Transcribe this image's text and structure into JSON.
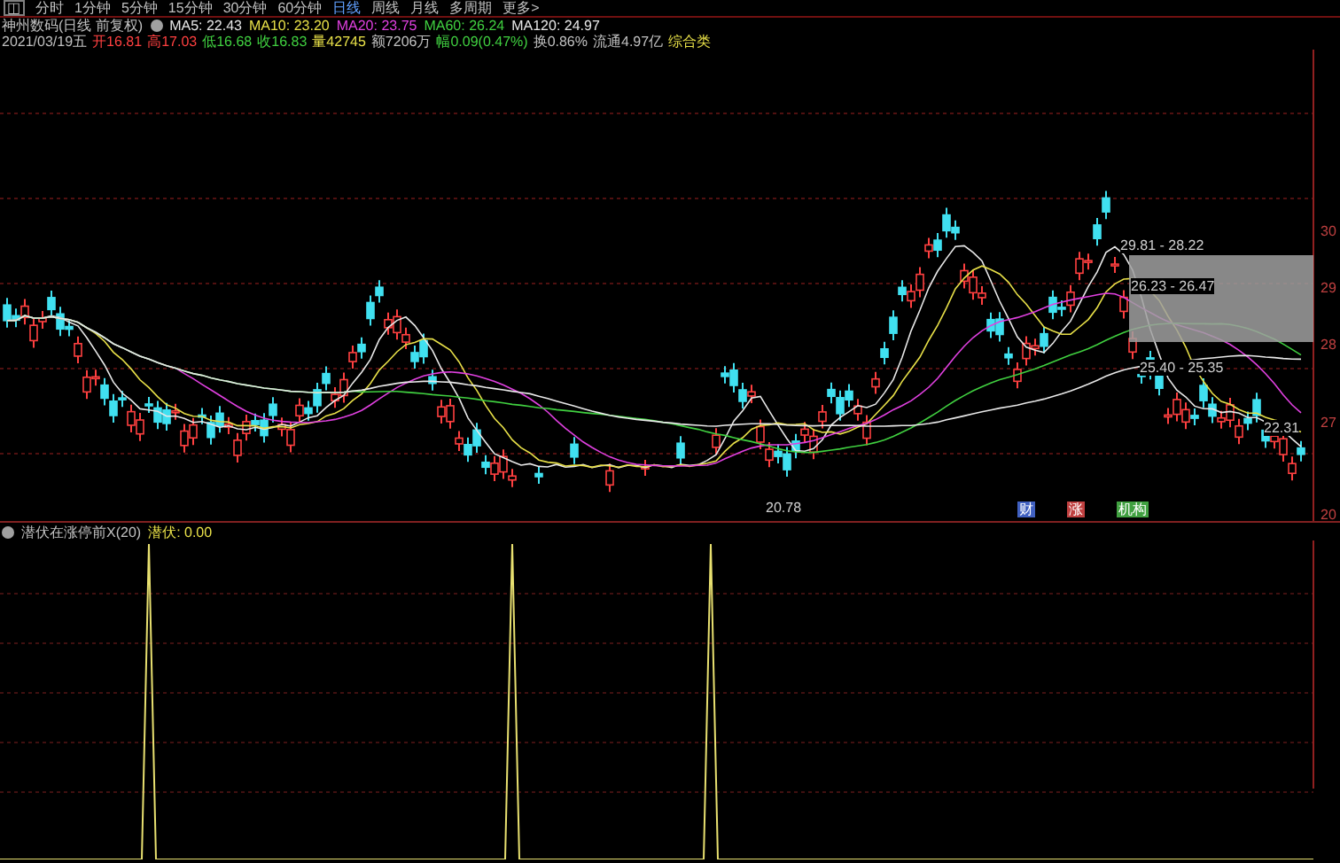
{
  "toolbar": {
    "icon": "◫",
    "tabs": [
      {
        "label": "分时",
        "selected": false
      },
      {
        "label": "1分钟",
        "selected": false
      },
      {
        "label": "5分钟",
        "selected": false
      },
      {
        "label": "15分钟",
        "selected": false
      },
      {
        "label": "30分钟",
        "selected": false
      },
      {
        "label": "60分钟",
        "selected": false
      },
      {
        "label": "日线",
        "selected": true
      },
      {
        "label": "周线",
        "selected": false
      },
      {
        "label": "月线",
        "selected": false
      },
      {
        "label": "多周期",
        "selected": false
      },
      {
        "label": "更多>",
        "selected": false
      }
    ]
  },
  "legend": {
    "title": "神州数码(日线 前复权)",
    "items": [
      {
        "label": "MA5: 22.43",
        "color": "#e8e8e8"
      },
      {
        "label": "MA10: 23.20",
        "color": "#e8e048"
      },
      {
        "label": "MA20: 23.75",
        "color": "#e040e0"
      },
      {
        "label": "MA60: 26.24",
        "color": "#40d040"
      },
      {
        "label": "MA120: 24.97",
        "color": "#e8e8e8"
      }
    ]
  },
  "quote": [
    {
      "label": "2021/03/19五",
      "color": "#c0c0c0"
    },
    {
      "label": "开16.81",
      "color": "#ff4040"
    },
    {
      "label": "高17.03",
      "color": "#ff4040"
    },
    {
      "label": "低16.68",
      "color": "#40d040"
    },
    {
      "label": "收16.83",
      "color": "#40d040"
    },
    {
      "label": "量42745",
      "color": "#e8e048"
    },
    {
      "label": "额7206万",
      "color": "#c0c0c0"
    },
    {
      "label": "幅0.09(0.47%)",
      "color": "#40d040"
    },
    {
      "label": "换0.86%",
      "color": "#c0c0c0"
    },
    {
      "label": "流通4.97亿",
      "color": "#c0c0c0"
    },
    {
      "label": "综合类",
      "color": "#e8e048"
    }
  ],
  "price_labels": [
    "29.81 - 28.22",
    "26.23 - 26.47",
    "25.40 - 25.35",
    "22.31",
    "20.78"
  ],
  "axis_labels": [
    "30",
    "29",
    "28",
    "27",
    "20"
  ],
  "badges": [
    {
      "label": "财",
      "color": "#4060c0"
    },
    {
      "label": "涨",
      "color": "#c04040"
    },
    {
      "label": "机构",
      "color": "#40a040"
    }
  ],
  "indicator": {
    "name": "潜伏在涨停前X(20)",
    "value": "潜伏: 0.00"
  }
}
